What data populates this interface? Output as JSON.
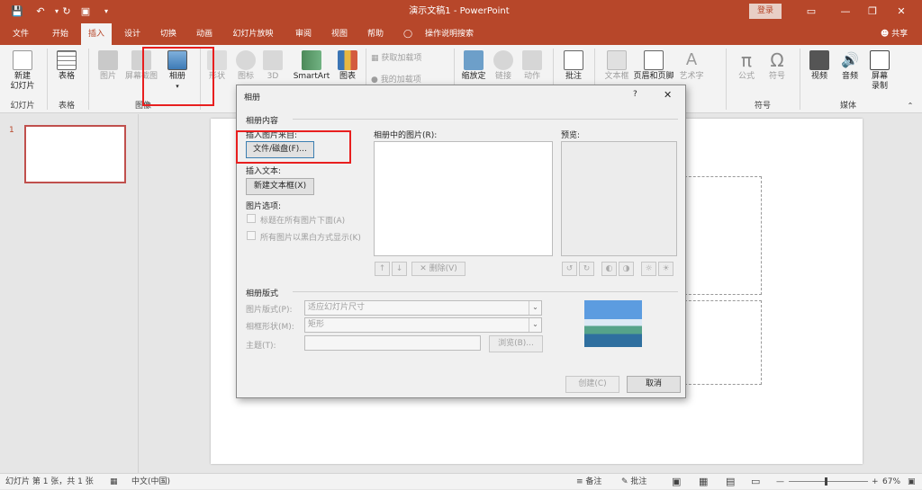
{
  "titlebar": {
    "doc_title": "演示文稿1 - PowerPoint",
    "login": "登录",
    "save_icon": "save-icon",
    "undo_icon": "undo-icon",
    "redo_icon": "redo-icon",
    "slideshow_icon": "present-icon"
  },
  "tabs": [
    "文件",
    "开始",
    "插入",
    "设计",
    "切换",
    "动画",
    "幻灯片放映",
    "审阅",
    "视图",
    "帮助",
    "操作说明搜索"
  ],
  "share": "共享",
  "ribbon": {
    "new_slide": "新建\n幻灯片",
    "group_slides": "幻灯片",
    "table": "表格",
    "group_table": "表格",
    "picture": "图片",
    "screenshot": "屏幕截图",
    "album": "相册",
    "group_image": "图像",
    "shapes": "形状",
    "icons": "图标",
    "model3d": "3D",
    "smartart": "SmartArt",
    "chart": "图表",
    "get_addins": "获取加载项",
    "my_addins": "我的加载项",
    "zoom": "缩放定",
    "link": "链接",
    "action": "动作",
    "comment": "批注",
    "textbox": "文本框",
    "header_footer": "页眉和页脚",
    "wordart": "艺术字",
    "equation": "公式",
    "symbol": "符号",
    "group_symbol": "符号",
    "video": "视频",
    "audio": "音频",
    "screen_rec": "屏幕\n录制",
    "group_media": "媒体"
  },
  "slide_number": "1",
  "dialog": {
    "title": "相册",
    "help": "?",
    "section_content": "相册内容",
    "insert_from": "插入图片来自:",
    "file_disk_btn": "文件/磁盘(F)...",
    "insert_text": "插入文本:",
    "new_textbox_btn": "新建文本框(X)",
    "pic_options": "图片选项:",
    "opt_caption": "标题在所有图片下面(A)",
    "opt_bw": "所有图片以黑白方式显示(K)",
    "pics_in_album": "相册中的图片(R):",
    "preview": "预览:",
    "delete_btn": "删除(V)",
    "section_layout": "相册版式",
    "pic_layout_label": "图片版式(P):",
    "pic_layout_value": "适应幻灯片尺寸",
    "frame_label": "相框形状(M):",
    "frame_value": "矩形",
    "theme_label": "主题(T):",
    "browse_btn": "浏览(B)...",
    "create_btn": "创建(C)",
    "cancel_btn": "取消"
  },
  "status": {
    "slide_info": "幻灯片 第 1 张，共 1 张",
    "language": "中文(中国)",
    "notes": "备注",
    "comments": "批注",
    "zoom": "67%"
  },
  "colors": {
    "accent": "#b7472a",
    "highlight": "#e81f1f"
  }
}
